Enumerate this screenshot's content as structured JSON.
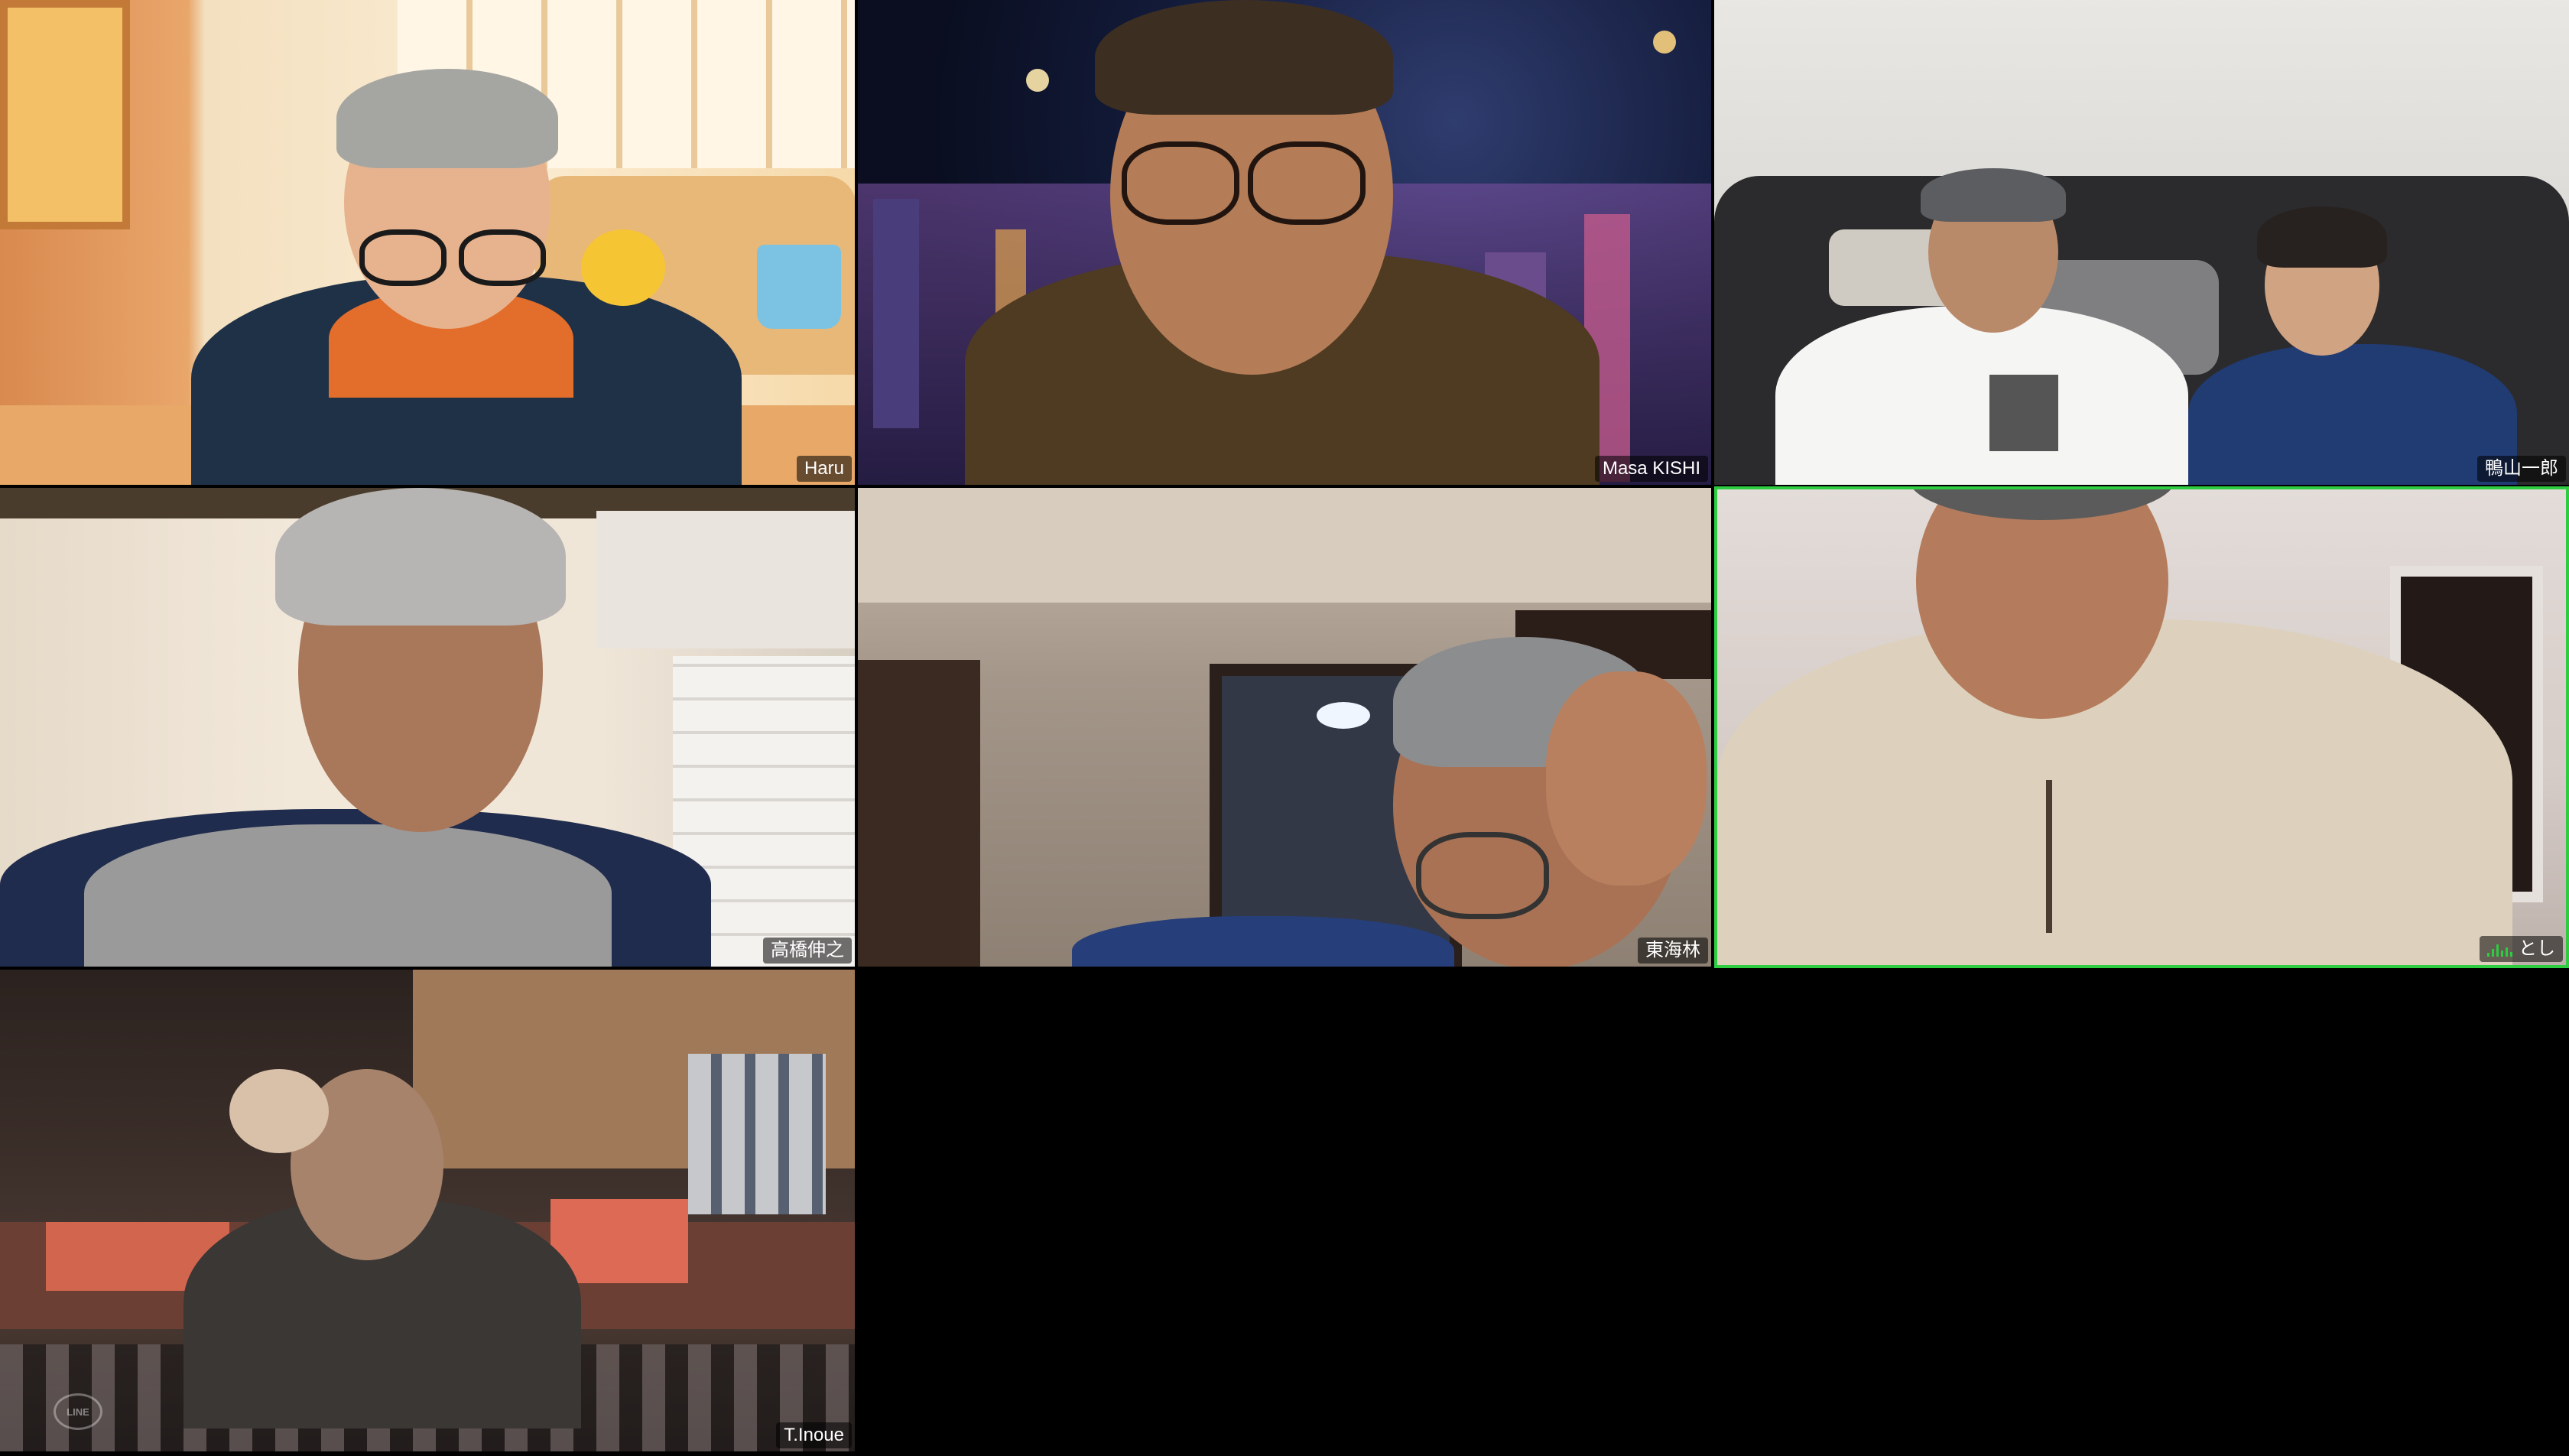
{
  "app": "Video meeting gallery view",
  "participants": [
    {
      "name": "Haru",
      "active": false
    },
    {
      "name": "Masa KISHI",
      "active": false
    },
    {
      "name": "鴨山一郎",
      "active": false
    },
    {
      "name": "高橋伸之",
      "active": false
    },
    {
      "name": "東海林",
      "active": false
    },
    {
      "name": "とし",
      "active": true,
      "speaking": true
    },
    {
      "name": "T.Inoue",
      "active": false
    }
  ],
  "overlay": {
    "logo_text": "LINE"
  },
  "colors": {
    "background": "#000000",
    "active_speaker_border": "#2ecc40",
    "nametag_text": "#ffffff"
  },
  "icons": {
    "speaking_indicator": "audio-level-icon"
  }
}
